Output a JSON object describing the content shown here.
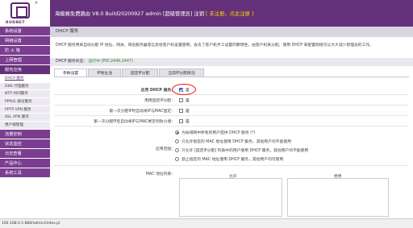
{
  "header": {
    "logo_brand": "RODNET",
    "title": "海蜘蛛免费路由 V8.0   Build20200927   admin [超级管理员] 注销",
    "warning": "[ 未注册，点此注册 ]"
  },
  "sidebar": {
    "items": [
      {
        "label": "系统设置"
      },
      {
        "label": "网络设置"
      },
      {
        "label": "防 火 墙"
      },
      {
        "label": "上网管理"
      },
      {
        "label": "服务应用"
      }
    ],
    "subitems": [
      {
        "label": "DHCP 服务"
      },
      {
        "label": "DNS 代理服务"
      },
      {
        "label": "NTP 时间服务"
      },
      {
        "label": "PPPoE 拨号服务"
      },
      {
        "label": "PPTP VPN 服务"
      },
      {
        "label": "SSL VPN 服务"
      },
      {
        "label": "用户端管理"
      }
    ],
    "after": [
      {
        "label": "流量控制"
      },
      {
        "label": "状态监控"
      },
      {
        "label": "日志查看"
      },
      {
        "label": "产品中心"
      },
      {
        "label": "系统工具"
      }
    ]
  },
  "status_bar": {
    "url": "192.168.0.1:880/admin/index.pl"
  },
  "content": {
    "page_title": "DHCP 服务",
    "description": "DHCP 服务用来自动分配 IP 地址、网关、域名服务器等信息给客户机设置使用，省去了客户机手工设置的繁琐性，由客户机来分配，使用 DHCP 来配置网络可以大大减少管理员的工作。",
    "state_label": "DHCP 服务状态：",
    "state_value": "运行中 (PID:2446,2447)",
    "tabs": [
      {
        "label": "参数设置"
      },
      {
        "label": "IP地址池"
      },
      {
        "label": "固定IP分配"
      },
      {
        "label": "当前IP分配情况"
      }
    ],
    "fields": {
      "enable_label": "启用 DHCP 服务：",
      "enable_value": "是",
      "auth_label": "用用固定IP分配：",
      "auth_value": "是",
      "first_label": "第一次分配IP时自动将IP与MAC固定：",
      "first_value": "是",
      "reassign_label": "第一次分配IP后自动将IP与MAC绑定到防火墙：",
      "reassign_value": "是",
      "policy_label": "应用范围：",
      "policy_options": [
        "为局域网中所有的用户提供 DHCP 服务 (*)",
        "只允许指定的 MAC 地址使用 DHCP 服务，其他用户均不能使用",
        "只允许 [固定IP分配] 列表中的用户使用 DHCP 服务，其他用户均不能使用",
        "禁止指定的 MAC 地址使用 DHCP 服务，其他用户均可使用"
      ],
      "mac_label": "MAC 地址列表：",
      "mac_allow": "允许",
      "mac_deny": "拒绝"
    }
  }
}
